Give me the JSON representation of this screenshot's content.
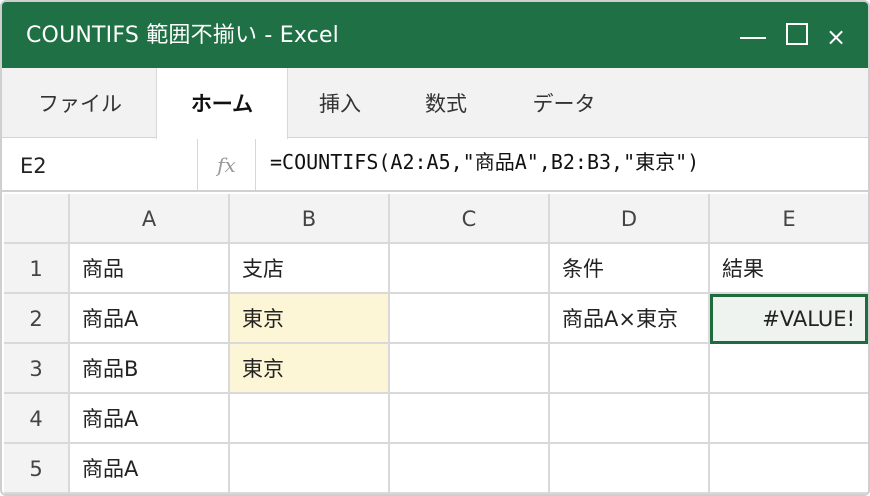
{
  "window": {
    "title": "COUNTIFS 範囲不揃い - Excel",
    "controls": {
      "close_glyph": "×"
    }
  },
  "ribbon": {
    "tabs": [
      {
        "label": "ファイル",
        "active": false
      },
      {
        "label": "ホーム",
        "active": true
      },
      {
        "label": "挿入",
        "active": false
      },
      {
        "label": "数式",
        "active": false
      },
      {
        "label": "データ",
        "active": false
      }
    ]
  },
  "formula_bar": {
    "name_box": "E2",
    "fx_label": "fx",
    "formula": "=COUNTIFS(A2:A5,\"商品A\",B2:B3,\"東京\")"
  },
  "sheet": {
    "columns": [
      "A",
      "B",
      "C",
      "D",
      "E"
    ],
    "rows": [
      {
        "number": "1",
        "cells": [
          "商品",
          "支店",
          "",
          "条件",
          "結果"
        ]
      },
      {
        "number": "2",
        "cells": [
          "商品A",
          "東京",
          "",
          "商品A×東京",
          "#VALUE!"
        ]
      },
      {
        "number": "3",
        "cells": [
          "商品B",
          "東京",
          "",
          "",
          ""
        ]
      },
      {
        "number": "4",
        "cells": [
          "商品A",
          "",
          "",
          "",
          ""
        ]
      },
      {
        "number": "5",
        "cells": [
          "商品A",
          "",
          "",
          "",
          ""
        ]
      }
    ],
    "selected_cell": "E2",
    "colors": {
      "title_bar": "#1f7145",
      "highlight_fill": "#fdf6d6",
      "selection_border": "#1f6b3d"
    }
  }
}
